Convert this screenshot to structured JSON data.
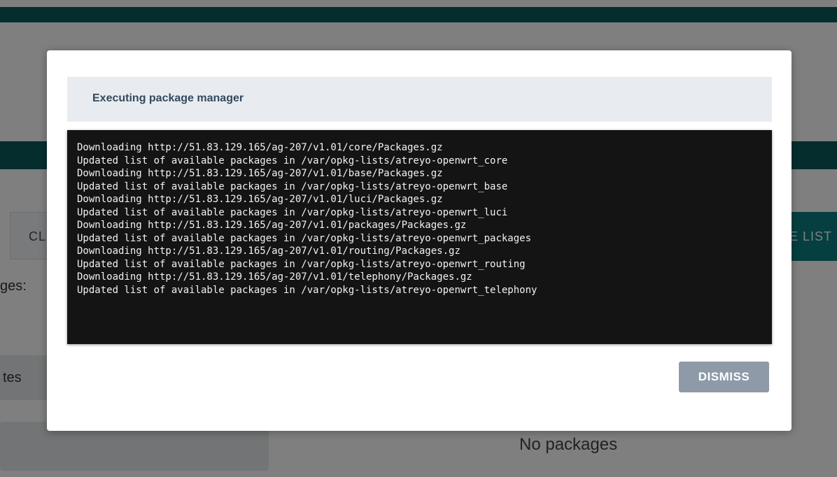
{
  "background": {
    "clear_button_label": "CL",
    "update_button_label": "E LIST",
    "packages_label": "ges:",
    "updates_tab_label": "tes",
    "no_packages_text": "No packages"
  },
  "modal": {
    "title": "Executing package manager",
    "console_lines": [
      "Downloading http://51.83.129.165/ag-207/v1.01/core/Packages.gz",
      "Updated list of available packages in /var/opkg-lists/atreyo-openwrt_core",
      "Downloading http://51.83.129.165/ag-207/v1.01/base/Packages.gz",
      "Updated list of available packages in /var/opkg-lists/atreyo-openwrt_base",
      "Downloading http://51.83.129.165/ag-207/v1.01/luci/Packages.gz",
      "Updated list of available packages in /var/opkg-lists/atreyo-openwrt_luci",
      "Downloading http://51.83.129.165/ag-207/v1.01/packages/Packages.gz",
      "Updated list of available packages in /var/opkg-lists/atreyo-openwrt_packages",
      "Downloading http://51.83.129.165/ag-207/v1.01/routing/Packages.gz",
      "Updated list of available packages in /var/opkg-lists/atreyo-openwrt_routing",
      "Downloading http://51.83.129.165/ag-207/v1.01/telephony/Packages.gz",
      "Updated list of available packages in /var/opkg-lists/atreyo-openwrt_telephony"
    ],
    "dismiss_label": "DISMISS"
  },
  "colors": {
    "header_teal": "#0b5a5a",
    "console_bg": "#141414",
    "dismiss_bg": "#8e9aa8",
    "title_color": "#34495e"
  }
}
